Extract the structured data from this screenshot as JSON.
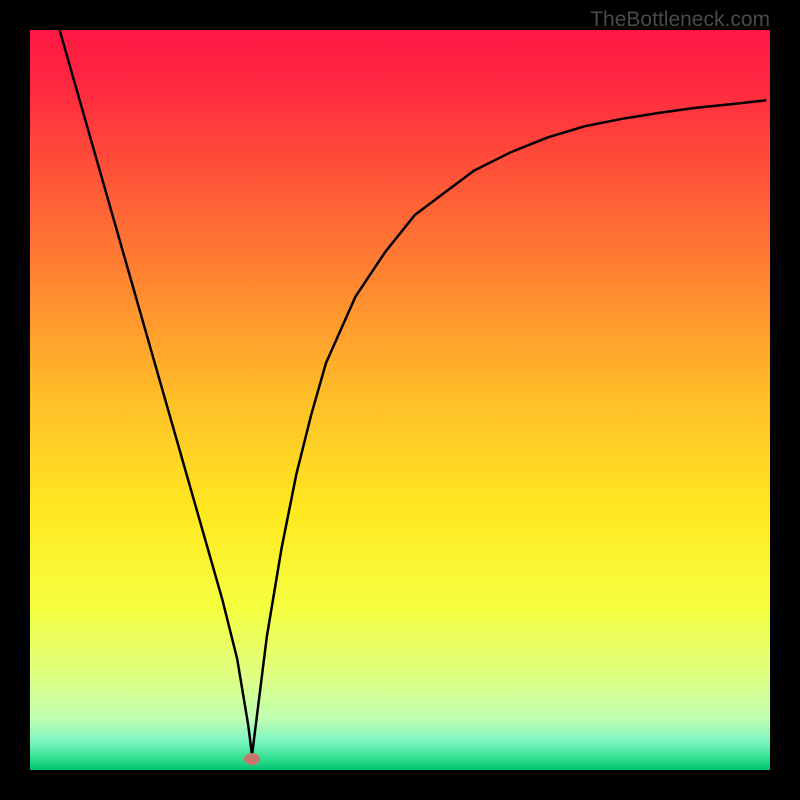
{
  "watermark": "TheBottleneck.com",
  "chart_data": {
    "type": "line",
    "title": "",
    "xlabel": "",
    "ylabel": "",
    "x": [
      0.04,
      0.06,
      0.08,
      0.1,
      0.12,
      0.14,
      0.16,
      0.18,
      0.2,
      0.22,
      0.24,
      0.26,
      0.28,
      0.295,
      0.3,
      0.305,
      0.32,
      0.34,
      0.36,
      0.38,
      0.4,
      0.44,
      0.48,
      0.52,
      0.56,
      0.6,
      0.65,
      0.7,
      0.75,
      0.8,
      0.85,
      0.9,
      0.95,
      0.995
    ],
    "y": [
      1.0,
      0.93,
      0.86,
      0.79,
      0.72,
      0.65,
      0.58,
      0.51,
      0.44,
      0.37,
      0.3,
      0.23,
      0.15,
      0.06,
      0.02,
      0.06,
      0.18,
      0.3,
      0.4,
      0.48,
      0.55,
      0.64,
      0.7,
      0.75,
      0.78,
      0.81,
      0.835,
      0.855,
      0.87,
      0.88,
      0.888,
      0.895,
      0.9,
      0.905
    ],
    "marker": {
      "x": 0.3,
      "y": 0.015
    },
    "gradient_stops": [
      {
        "offset": 0.0,
        "color": "#ff1744"
      },
      {
        "offset": 0.08,
        "color": "#ff2a3f"
      },
      {
        "offset": 0.2,
        "color": "#ff5538"
      },
      {
        "offset": 0.35,
        "color": "#ff8a30"
      },
      {
        "offset": 0.5,
        "color": "#ffbf28"
      },
      {
        "offset": 0.65,
        "color": "#ffe820"
      },
      {
        "offset": 0.78,
        "color": "#f5ff40"
      },
      {
        "offset": 0.87,
        "color": "#e0ff80"
      },
      {
        "offset": 0.93,
        "color": "#c0ffb0"
      },
      {
        "offset": 0.96,
        "color": "#80f5c0"
      },
      {
        "offset": 0.985,
        "color": "#30e090"
      },
      {
        "offset": 1.0,
        "color": "#00c070"
      }
    ],
    "green_band_start": 0.96
  }
}
